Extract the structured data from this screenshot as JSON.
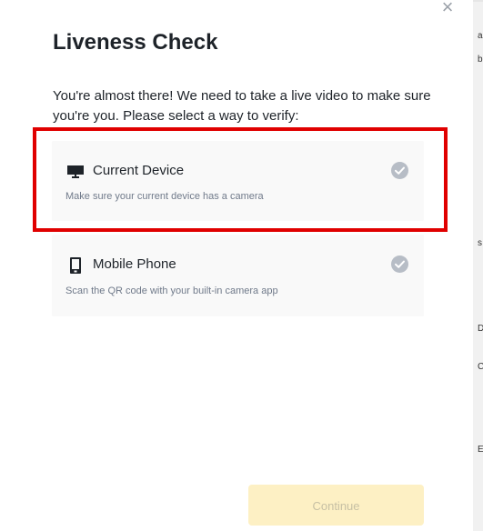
{
  "modal": {
    "close_label": "×",
    "title": "Liveness Check",
    "instructions": "You're almost there! We need to take a live video to make sure you're you. Please select a way to verify:",
    "options": [
      {
        "icon": "monitor-icon",
        "title": "Current Device",
        "description": "Make sure your current device has a camera",
        "selected": false
      },
      {
        "icon": "mobile-phone-icon",
        "title": "Mobile Phone",
        "description": "Scan the QR code with your built-in camera app",
        "selected": false
      }
    ],
    "continue_label": "Continue",
    "continue_enabled": false
  },
  "colors": {
    "highlight": "#e00000",
    "check_inactive": "#b7bdc6",
    "continue_disabled_bg": "#fdf0c4",
    "continue_disabled_text": "#c7c0a4"
  },
  "background_edge": {
    "glyphs": [
      "a",
      "b",
      "s",
      "D",
      "C",
      "E"
    ]
  }
}
